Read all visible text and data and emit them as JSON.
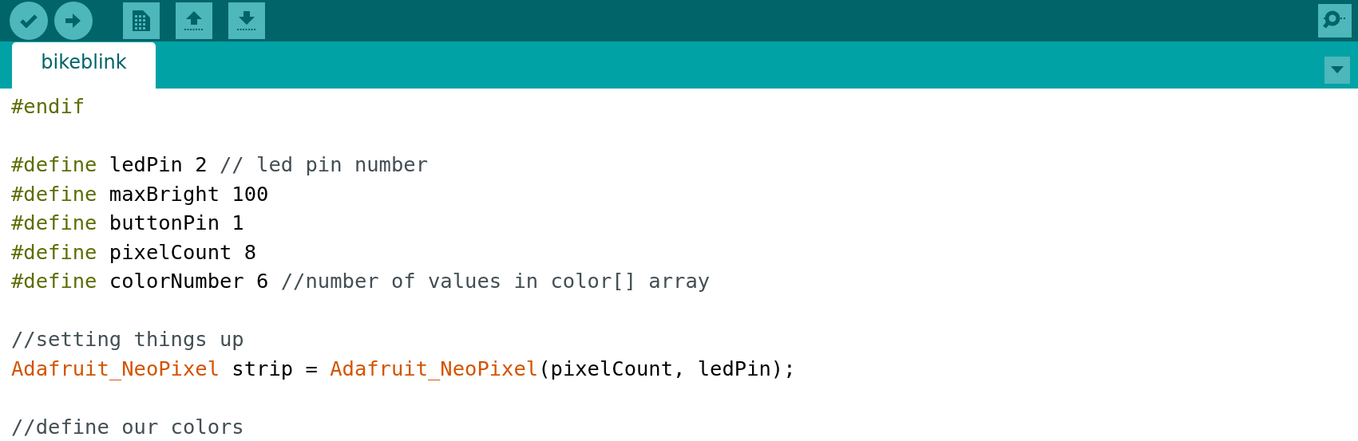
{
  "toolbar": {
    "buttons": [
      {
        "kind": "verify"
      },
      {
        "kind": "upload"
      },
      {
        "kind": "new"
      },
      {
        "kind": "open"
      },
      {
        "kind": "save"
      }
    ],
    "right_button": {
      "kind": "serial"
    }
  },
  "tabs": [
    {
      "label": "bikeblink",
      "selected": true
    }
  ],
  "editor": {
    "blocks": [
      [
        [
          {
            "kind": "directive",
            "text": "#endif"
          }
        ]
      ],
      [
        [
          {
            "kind": "directive",
            "text": "#define"
          },
          {
            "kind": "plain",
            "text": " ledPin 2 "
          },
          {
            "kind": "comment",
            "text": "// led pin number"
          }
        ],
        [
          {
            "kind": "directive",
            "text": "#define"
          },
          {
            "kind": "plain",
            "text": " maxBright 100"
          }
        ],
        [
          {
            "kind": "directive",
            "text": "#define"
          },
          {
            "kind": "plain",
            "text": " buttonPin 1"
          }
        ],
        [
          {
            "kind": "directive",
            "text": "#define"
          },
          {
            "kind": "plain",
            "text": " pixelCount 8"
          }
        ],
        [
          {
            "kind": "directive",
            "text": "#define"
          },
          {
            "kind": "plain",
            "text": " colorNumber 6 "
          },
          {
            "kind": "comment",
            "text": "//number of values in color[] array"
          }
        ]
      ],
      [
        [
          {
            "kind": "comment",
            "text": "//setting things up"
          }
        ],
        [
          {
            "kind": "type",
            "text": "Adafruit_NeoPixel"
          },
          {
            "kind": "plain",
            "text": " strip = "
          },
          {
            "kind": "type",
            "text": "Adafruit_NeoPixel"
          },
          {
            "kind": "plain",
            "text": "(pixelCount, ledPin);"
          }
        ]
      ],
      [
        [
          {
            "kind": "comment",
            "text": "//define our colors"
          }
        ]
      ]
    ]
  }
}
